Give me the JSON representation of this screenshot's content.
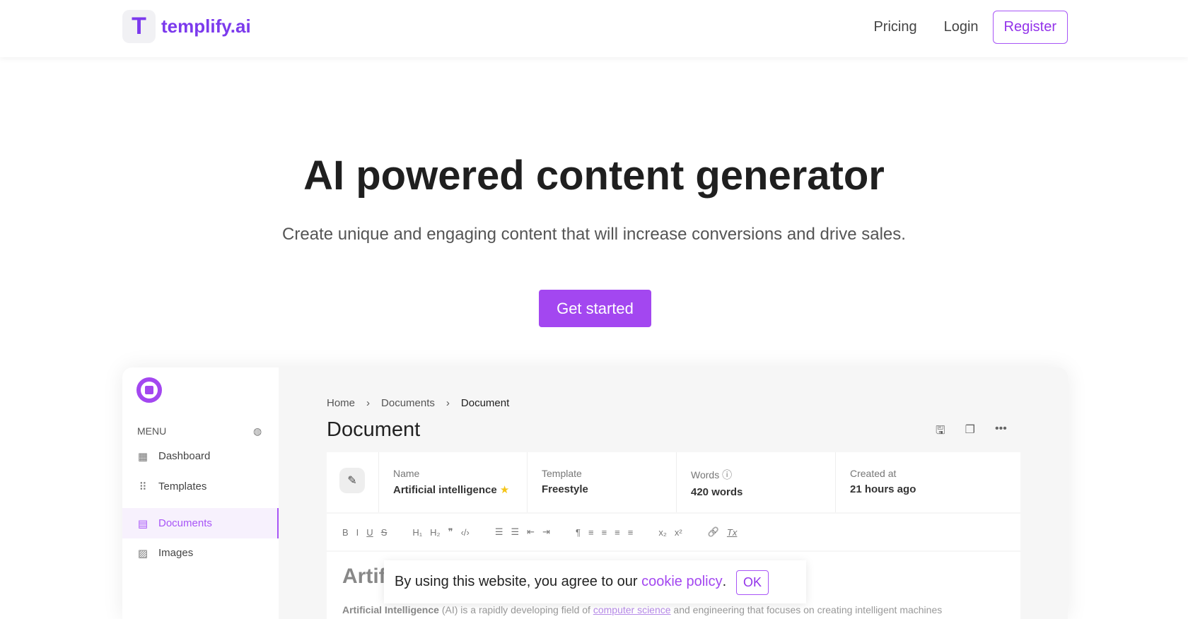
{
  "header": {
    "logo_mark": "T",
    "logo_text": "templify.ai",
    "nav": [
      "Pricing",
      "Login"
    ],
    "register": "Register"
  },
  "hero": {
    "title": "AI powered content generator",
    "subtitle": "Create unique and engaging content that will increase conversions and drive sales.",
    "cta": "Get started"
  },
  "app": {
    "menu_label": "MENU",
    "sidebar": [
      {
        "label": "Dashboard",
        "icon": "grid-icon"
      },
      {
        "label": "Templates",
        "icon": "dots-grid-icon"
      },
      {
        "label": "Documents",
        "icon": "document-icon",
        "active": true
      },
      {
        "label": "Images",
        "icon": "image-icon"
      }
    ],
    "breadcrumb": [
      "Home",
      "Documents",
      "Document"
    ],
    "title": "Document",
    "info": [
      {
        "label": "Name",
        "value": "Artificial intelligence"
      },
      {
        "label": "Template",
        "value": "Freestyle"
      },
      {
        "label": "Words",
        "value": "420 words"
      },
      {
        "label": "Created at",
        "value": "21 hours ago"
      }
    ],
    "toolbar": [
      "B",
      "I",
      "U",
      "S",
      "H₁",
      "H₂",
      "❞",
      "‹/›",
      "☰",
      "☰",
      "⇤",
      "⇥",
      "¶",
      "≡",
      "≡",
      "≡",
      "≡",
      "x₂",
      "x²",
      "🔗",
      "Tx"
    ],
    "editor": {
      "heading": "Artificial Intelligence",
      "bold": "Artificial Intelligence",
      "p1": " (AI) is a rapidly developing field of ",
      "link": "computer science",
      "p2": " and engineering that focuses on creating intelligent machines"
    }
  },
  "cookie": {
    "text": "By using this website, you agree to our ",
    "link": "cookie policy",
    "end": ".",
    "ok": "OK"
  },
  "colors": {
    "accent": "#a347f0"
  }
}
